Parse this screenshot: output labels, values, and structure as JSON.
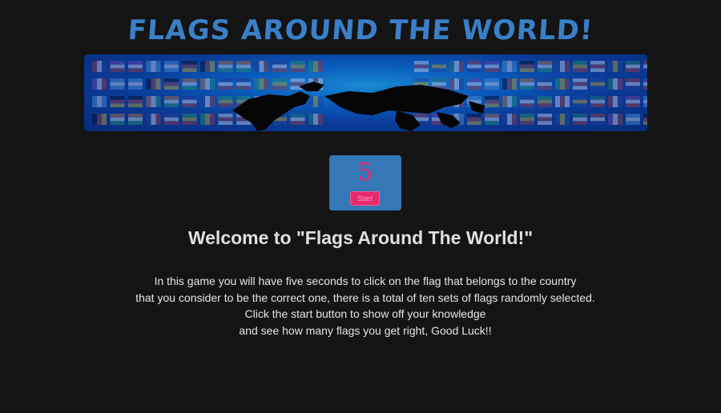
{
  "header": {
    "title": "FLAGS AROUND THE WORLD!"
  },
  "banner": {
    "image": "world-flags-banner"
  },
  "timer": {
    "count": "5",
    "start_label": "Start"
  },
  "welcome": {
    "heading": "Welcome to \"Flags Around The World!\""
  },
  "instructions": {
    "lines": [
      "In this game you will have five seconds to click on the flag that belongs to the country",
      "that you consider to be the correct one, there is a total of ten sets of flags randomly selected.",
      "Click the start button to show off your knowledge",
      "and see how many flags you get right, Good Luck!!"
    ]
  },
  "colors": {
    "background": "#141414",
    "title": "#3a7fc8",
    "timer_box": "#3677b8",
    "accent": "#e8296e"
  }
}
